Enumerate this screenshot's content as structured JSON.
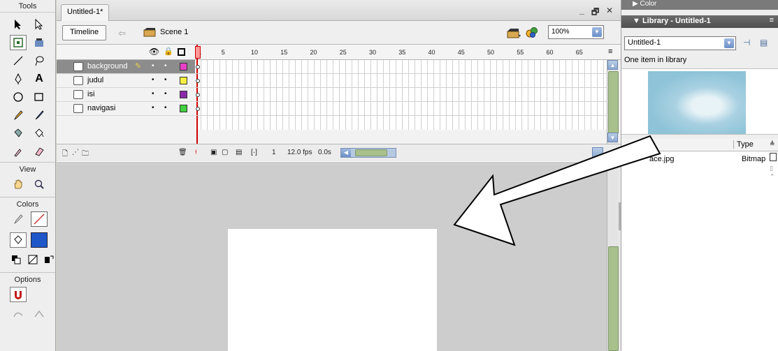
{
  "tools": {
    "title": "Tools",
    "sections": {
      "view": "View",
      "colors": "Colors",
      "options": "Options"
    },
    "items": [
      "arrow-icon",
      "subselect-icon",
      "free-transform-icon",
      "fill-transform-icon",
      "line-icon",
      "lasso-icon",
      "pen-icon",
      "text-icon",
      "oval-icon",
      "rectangle-icon",
      "pencil-icon",
      "brush-icon",
      "ink-bottle-icon",
      "paint-bucket-icon",
      "eyedropper-icon",
      "eraser-icon"
    ],
    "colors": {
      "stroke": "#cc3333",
      "fill": "#1f57c8"
    }
  },
  "document": {
    "tab": "Untitled-1*",
    "window_controls": {
      "minimize": "_",
      "restore": "🗗",
      "close": "✕"
    },
    "timeline_button": "Timeline",
    "scene": "Scene 1",
    "zoom": "100%"
  },
  "timeline": {
    "frame_numbers": [
      "1",
      "5",
      "10",
      "15",
      "20",
      "25",
      "30",
      "35",
      "40",
      "45",
      "50",
      "55",
      "60",
      "65"
    ],
    "layers": [
      {
        "name": "background",
        "color": "#e83ec8",
        "selected": true
      },
      {
        "name": "judul",
        "color": "#f8f040",
        "selected": false
      },
      {
        "name": "isi",
        "color": "#8a2aa8",
        "selected": false
      },
      {
        "name": "navigasi",
        "color": "#40d040",
        "selected": false
      }
    ],
    "status": {
      "current_frame": "1",
      "fps": "12.0 fps",
      "time": "0.0s"
    }
  },
  "right_panel": {
    "color_title": "Color",
    "library_title": "Library - Untitled-1",
    "library_select": "Untitled-1",
    "library_count": "One item in library",
    "col_type": "Type",
    "item_name": "ace.jpg",
    "item_type": "Bitmap"
  },
  "colors": {
    "playhead": "#cc0000",
    "scroll_thumb": "#a8c08c",
    "stage_bg": "#cdcdcd"
  }
}
